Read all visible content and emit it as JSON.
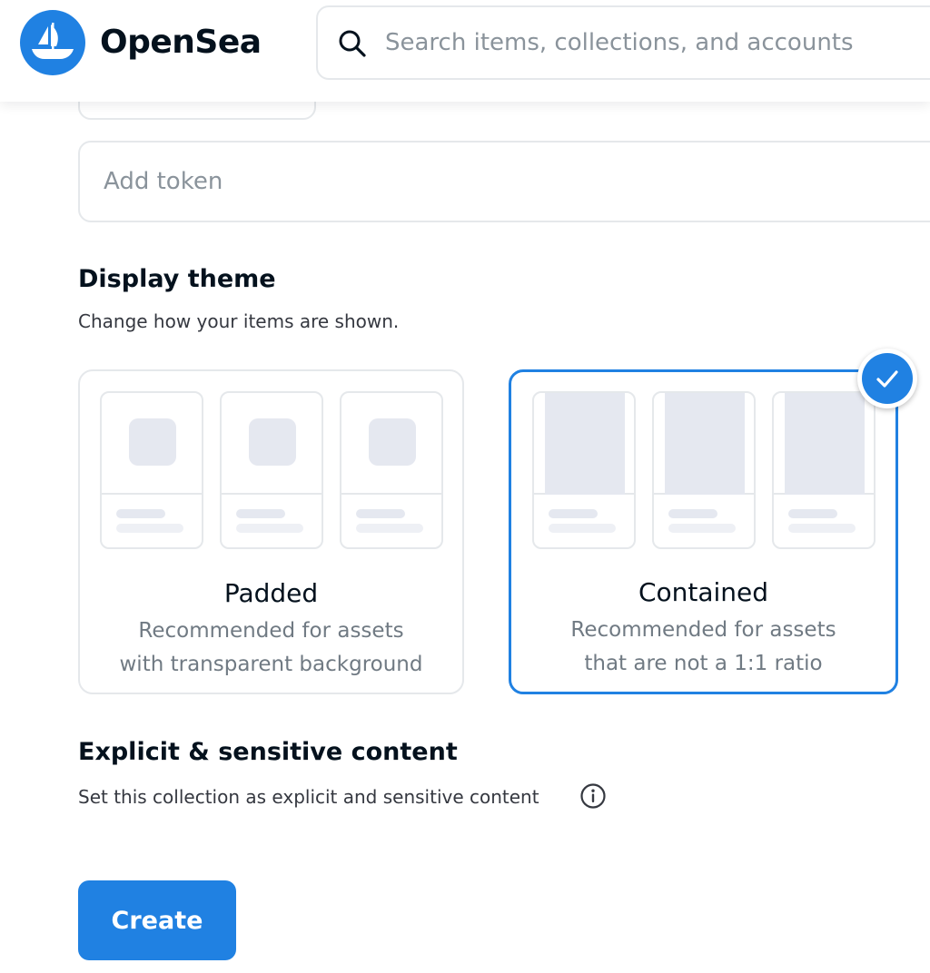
{
  "header": {
    "brand": "OpenSea",
    "search_placeholder": "Search items, collections, and accounts"
  },
  "form": {
    "token_placeholder": "Add token"
  },
  "display_theme": {
    "title": "Display theme",
    "description": "Change how your items are shown.",
    "options": [
      {
        "title": "Padded",
        "line1": "Recommended for assets",
        "line2": "with transparent background",
        "selected": false
      },
      {
        "title": "Contained",
        "line1": "Recommended for assets",
        "line2": "that are not a 1:1 ratio",
        "selected": true
      }
    ]
  },
  "explicit": {
    "title": "Explicit & sensitive content",
    "description": "Set this collection as explicit and sensitive content"
  },
  "actions": {
    "create_label": "Create"
  },
  "icons": {
    "logo": "opensea-ship-logo-icon",
    "search": "search-icon",
    "selected": "check-icon",
    "info": "info-icon"
  },
  "colors": {
    "accent": "#2081e2",
    "border": "#e5e8eb",
    "placeholder_text": "#8a939b",
    "muted_text": "#707a83"
  }
}
